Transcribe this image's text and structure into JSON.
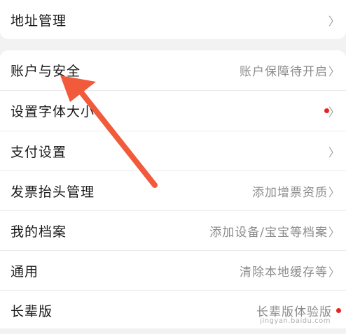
{
  "top_item": {
    "label": "地址管理",
    "chevron": "〉"
  },
  "items": [
    {
      "label": "账户与安全",
      "value": "账户保障待开启",
      "chevron": "〉",
      "dot": false
    },
    {
      "label": "设置字体大小",
      "value": "",
      "chevron": "〉",
      "dot": true
    },
    {
      "label": "支付设置",
      "value": "",
      "chevron": "〉",
      "dot": false
    },
    {
      "label": "发票抬头管理",
      "value": "添加增票资质",
      "chevron": "〉",
      "dot": false
    },
    {
      "label": "我的档案",
      "value": "添加设备/宝宝等档案",
      "chevron": "〉",
      "dot": false
    },
    {
      "label": "通用",
      "value": "清除本地缓存等",
      "chevron": "〉",
      "dot": false
    },
    {
      "label": "长辈版",
      "value": "长辈版体验版",
      "chevron": "",
      "dot": true
    }
  ],
  "watermark": "jingyan.baidu.com",
  "colors": {
    "accent_red": "#e8231c",
    "annotation_arrow": "#f15a3b"
  }
}
